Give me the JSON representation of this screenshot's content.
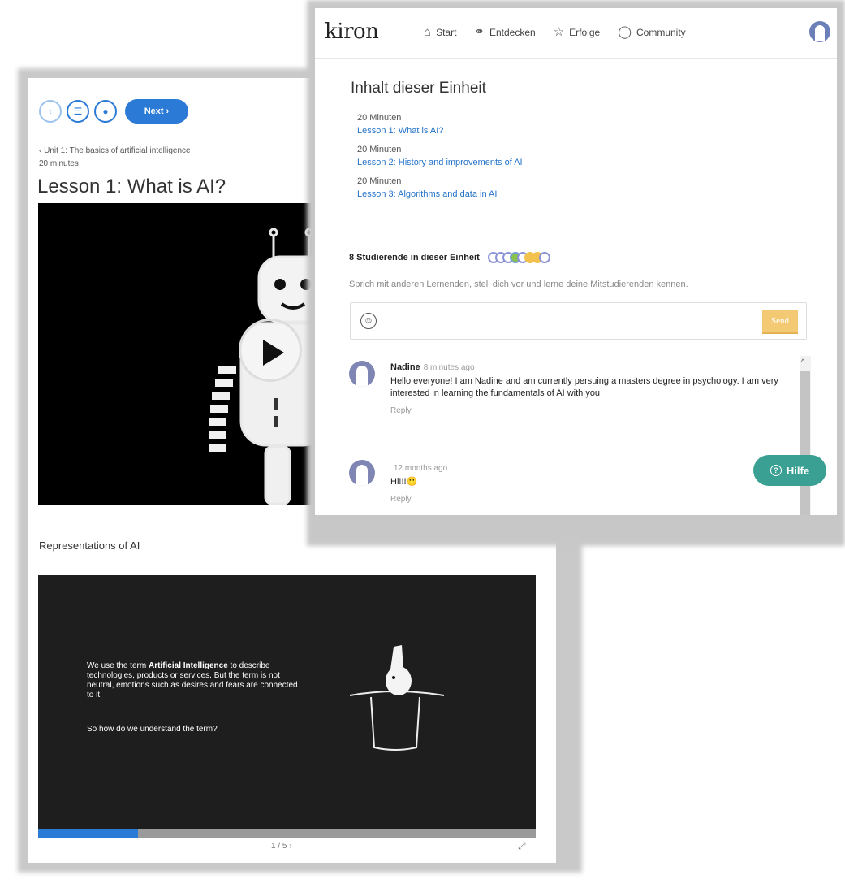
{
  "back_window": {
    "nav_buttons": {
      "back_icon": "‹",
      "toc_icon": "☰",
      "chat_icon": "●",
      "next_label": "Next ›"
    },
    "unit_link": "‹ Unit 1: The basics of artificial intelligence",
    "unit_minutes": "20 minutes",
    "lesson_title": "Lesson 1: What is AI?",
    "representations_title": "Representations of AI",
    "slide": {
      "text_prefix": "We use the term ",
      "text_bold": "Artificial Intelligence",
      "text_suffix": " to describe technologies, products or services. But the term is not neutral, emotions such as desires and fears are connected to it.",
      "question": "So how do we understand the term?",
      "pager": "1 / 5 ›",
      "expand_icon": "⤢",
      "progress_fraction": 0.2
    }
  },
  "front_window": {
    "logo": "kiron",
    "nav": [
      {
        "icon": "⌂",
        "label": "Start"
      },
      {
        "icon": "⚭",
        "label": "Entdecken"
      },
      {
        "icon": "☆",
        "label": "Erfolge"
      },
      {
        "icon": "◯",
        "label": "Community"
      }
    ],
    "content_title": "Inhalt dieser Einheit",
    "lessons": [
      {
        "minutes": "20 Minuten",
        "title": "Lesson 1: What is AI?"
      },
      {
        "minutes": "20 Minuten",
        "title": "Lesson 2: History and improvements of AI"
      },
      {
        "minutes": "20 Minuten",
        "title": "Lesson 3: Algorithms and data in AI"
      }
    ],
    "students_label": "8 Studierende in dieser Einheit",
    "chat_prompt": "Sprich mit anderen Lernenden, stell dich vor und lerne deine Mitstudierenden kennen.",
    "emoji_icon": "☺",
    "send_label": "Send",
    "comments": [
      {
        "name": "Nadine",
        "time": "8 minutes ago",
        "text": "Hello everyone! I am Nadine and am currently persuing a masters degree in psychology. I am very interested in learning the fundamentals of AI with you!",
        "reply": "Reply"
      },
      {
        "name": "",
        "time": "12 months ago",
        "text": "Hi!!!🙂",
        "reply": "Reply"
      }
    ],
    "scroll_up_icon": "^",
    "help_icon": "?",
    "help_label": "Hilfe"
  },
  "colors": {
    "accent_blue": "#2b7bd6",
    "link_blue": "#2473c8",
    "send_yellow": "#f3c973",
    "help_teal": "#3aa094"
  }
}
